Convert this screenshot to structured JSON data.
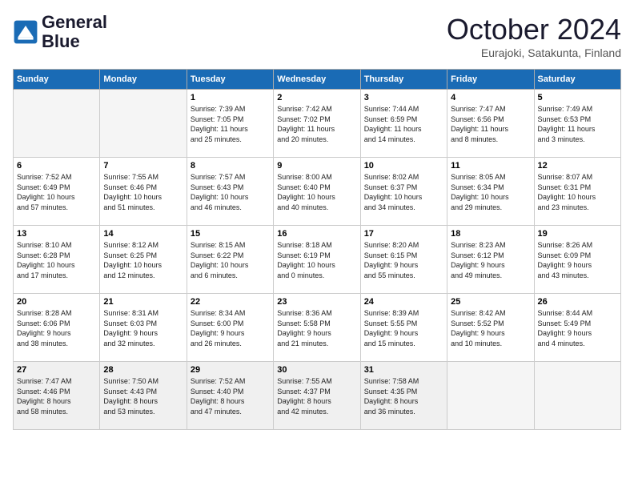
{
  "logo": {
    "line1": "General",
    "line2": "Blue"
  },
  "title": "October 2024",
  "subtitle": "Eurajoki, Satakunta, Finland",
  "days_of_week": [
    "Sunday",
    "Monday",
    "Tuesday",
    "Wednesday",
    "Thursday",
    "Friday",
    "Saturday"
  ],
  "weeks": [
    [
      {
        "day": "",
        "content": "",
        "empty": true
      },
      {
        "day": "",
        "content": "",
        "empty": true
      },
      {
        "day": "1",
        "content": "Sunrise: 7:39 AM\nSunset: 7:05 PM\nDaylight: 11 hours\nand 25 minutes."
      },
      {
        "day": "2",
        "content": "Sunrise: 7:42 AM\nSunset: 7:02 PM\nDaylight: 11 hours\nand 20 minutes."
      },
      {
        "day": "3",
        "content": "Sunrise: 7:44 AM\nSunset: 6:59 PM\nDaylight: 11 hours\nand 14 minutes."
      },
      {
        "day": "4",
        "content": "Sunrise: 7:47 AM\nSunset: 6:56 PM\nDaylight: 11 hours\nand 8 minutes."
      },
      {
        "day": "5",
        "content": "Sunrise: 7:49 AM\nSunset: 6:53 PM\nDaylight: 11 hours\nand 3 minutes."
      }
    ],
    [
      {
        "day": "6",
        "content": "Sunrise: 7:52 AM\nSunset: 6:49 PM\nDaylight: 10 hours\nand 57 minutes."
      },
      {
        "day": "7",
        "content": "Sunrise: 7:55 AM\nSunset: 6:46 PM\nDaylight: 10 hours\nand 51 minutes."
      },
      {
        "day": "8",
        "content": "Sunrise: 7:57 AM\nSunset: 6:43 PM\nDaylight: 10 hours\nand 46 minutes."
      },
      {
        "day": "9",
        "content": "Sunrise: 8:00 AM\nSunset: 6:40 PM\nDaylight: 10 hours\nand 40 minutes."
      },
      {
        "day": "10",
        "content": "Sunrise: 8:02 AM\nSunset: 6:37 PM\nDaylight: 10 hours\nand 34 minutes."
      },
      {
        "day": "11",
        "content": "Sunrise: 8:05 AM\nSunset: 6:34 PM\nDaylight: 10 hours\nand 29 minutes."
      },
      {
        "day": "12",
        "content": "Sunrise: 8:07 AM\nSunset: 6:31 PM\nDaylight: 10 hours\nand 23 minutes."
      }
    ],
    [
      {
        "day": "13",
        "content": "Sunrise: 8:10 AM\nSunset: 6:28 PM\nDaylight: 10 hours\nand 17 minutes."
      },
      {
        "day": "14",
        "content": "Sunrise: 8:12 AM\nSunset: 6:25 PM\nDaylight: 10 hours\nand 12 minutes."
      },
      {
        "day": "15",
        "content": "Sunrise: 8:15 AM\nSunset: 6:22 PM\nDaylight: 10 hours\nand 6 minutes."
      },
      {
        "day": "16",
        "content": "Sunrise: 8:18 AM\nSunset: 6:19 PM\nDaylight: 10 hours\nand 0 minutes."
      },
      {
        "day": "17",
        "content": "Sunrise: 8:20 AM\nSunset: 6:15 PM\nDaylight: 9 hours\nand 55 minutes."
      },
      {
        "day": "18",
        "content": "Sunrise: 8:23 AM\nSunset: 6:12 PM\nDaylight: 9 hours\nand 49 minutes."
      },
      {
        "day": "19",
        "content": "Sunrise: 8:26 AM\nSunset: 6:09 PM\nDaylight: 9 hours\nand 43 minutes."
      }
    ],
    [
      {
        "day": "20",
        "content": "Sunrise: 8:28 AM\nSunset: 6:06 PM\nDaylight: 9 hours\nand 38 minutes."
      },
      {
        "day": "21",
        "content": "Sunrise: 8:31 AM\nSunset: 6:03 PM\nDaylight: 9 hours\nand 32 minutes."
      },
      {
        "day": "22",
        "content": "Sunrise: 8:34 AM\nSunset: 6:00 PM\nDaylight: 9 hours\nand 26 minutes."
      },
      {
        "day": "23",
        "content": "Sunrise: 8:36 AM\nSunset: 5:58 PM\nDaylight: 9 hours\nand 21 minutes."
      },
      {
        "day": "24",
        "content": "Sunrise: 8:39 AM\nSunset: 5:55 PM\nDaylight: 9 hours\nand 15 minutes."
      },
      {
        "day": "25",
        "content": "Sunrise: 8:42 AM\nSunset: 5:52 PM\nDaylight: 9 hours\nand 10 minutes."
      },
      {
        "day": "26",
        "content": "Sunrise: 8:44 AM\nSunset: 5:49 PM\nDaylight: 9 hours\nand 4 minutes."
      }
    ],
    [
      {
        "day": "27",
        "content": "Sunrise: 7:47 AM\nSunset: 4:46 PM\nDaylight: 8 hours\nand 58 minutes."
      },
      {
        "day": "28",
        "content": "Sunrise: 7:50 AM\nSunset: 4:43 PM\nDaylight: 8 hours\nand 53 minutes."
      },
      {
        "day": "29",
        "content": "Sunrise: 7:52 AM\nSunset: 4:40 PM\nDaylight: 8 hours\nand 47 minutes."
      },
      {
        "day": "30",
        "content": "Sunrise: 7:55 AM\nSunset: 4:37 PM\nDaylight: 8 hours\nand 42 minutes."
      },
      {
        "day": "31",
        "content": "Sunrise: 7:58 AM\nSunset: 4:35 PM\nDaylight: 8 hours\nand 36 minutes."
      },
      {
        "day": "",
        "content": "",
        "empty": true
      },
      {
        "day": "",
        "content": "",
        "empty": true
      }
    ]
  ]
}
